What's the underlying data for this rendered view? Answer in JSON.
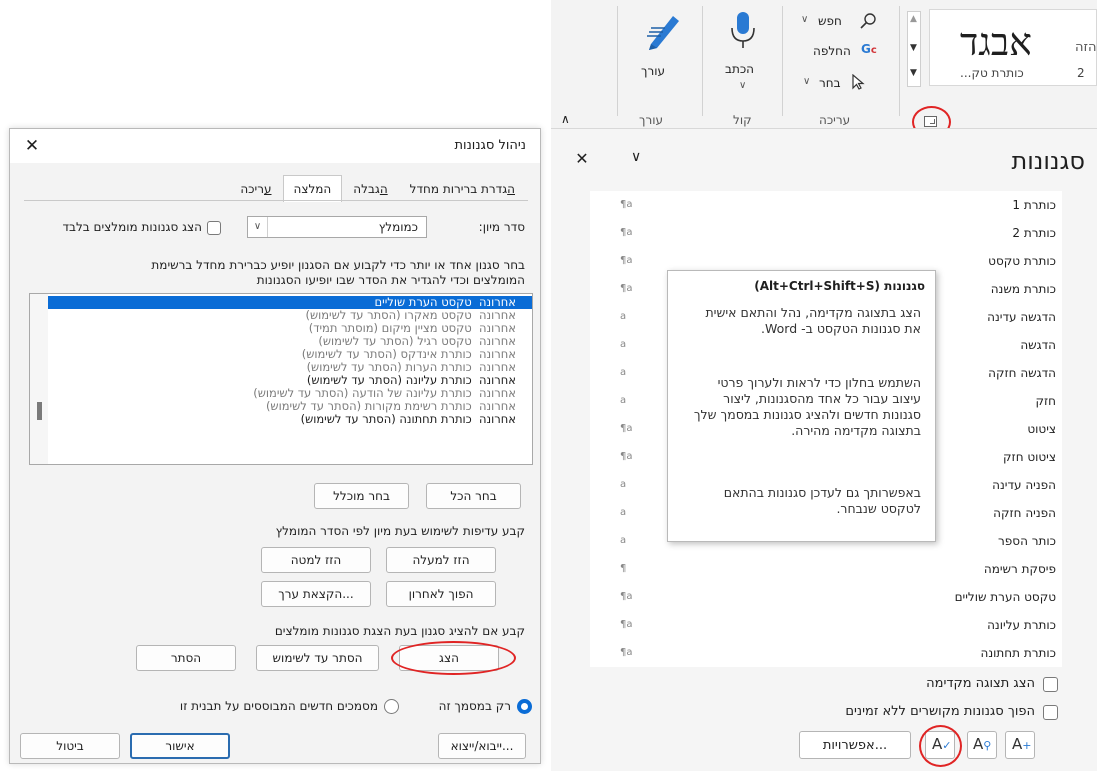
{
  "dialog": {
    "title": "ניהול סגנונות",
    "close_glyph": "✕",
    "tabs": [
      {
        "label": "עריכה",
        "underline": "ע",
        "rest": "ריכה"
      },
      {
        "label": "המלצה"
      },
      {
        "label": "הגבלה",
        "underline": "ה",
        "rest": "גבלה"
      },
      {
        "label": "הגדרת ברירות מחדל",
        "underline": "ה",
        "rest": "גדרת ברירות מחדל"
      }
    ],
    "sort_label": "סדר מיון:",
    "sort_value": "כמומלץ",
    "show_recommended_label": "הצג סגנונות מומלצים בלבד",
    "instructions": [
      "בחר סגנון אחד או יותר כדי לקבוע אם הסגנון יופיע כברירת מחדל ברשימת",
      "המומלצים וכדי להגדיר את הסדר שבו יופיעו הסגנונות"
    ],
    "list": [
      {
        "pri": "אחרונה",
        "text": "טקסט הערת שוליים"
      },
      {
        "pri": "אחרונה",
        "text": "טקסט מאקרו  (הסתר עד לשימוש)"
      },
      {
        "pri": "אחרונה",
        "text": "טקסט מציין מיקום  (מוסתר תמיד)"
      },
      {
        "pri": "אחרונה",
        "text": "טקסט רגיל  (הסתר עד לשימוש)"
      },
      {
        "pri": "אחרונה",
        "text": "כותרת אינדקס  (הסתר עד לשימוש)"
      },
      {
        "pri": "אחרונה",
        "text": "כותרת הערות  (הסתר עד לשימוש)"
      },
      {
        "pri": "אחרונה",
        "text": "כותרת עליונה  (הסתר עד לשימוש)"
      },
      {
        "pri": "אחרונה",
        "text": "כותרת עליונה של הודעה  (הסתר עד לשימוש)"
      },
      {
        "pri": "אחרונה",
        "text": "כותרת רשימת מקורות  (הסתר עד לשימוש)"
      },
      {
        "pri": "אחרונה",
        "text": "כותרת תחתונה  (הסתר עד לשימוש)"
      }
    ],
    "select_all": "בחר הכל",
    "select_builtin": "בחר מוכלל",
    "priority_label": "קבע עדיפות לשימוש בעת מיון לפי הסדר המומלץ",
    "move_up": "הזז למעלה",
    "move_down": "הזז למטה",
    "move_last": "הפוך לאחרון",
    "assign_value": "הקצאת ערך...",
    "visibility_label": "קבע אם להציג סגנון בעת הצגת סגנונות מומלצים",
    "show": "הצג",
    "hide_until_used": "הסתר עד לשימוש",
    "hide": "הסתר",
    "radio_this_doc": "רק במסמך זה",
    "radio_new_docs": "מסמכים חדשים המבוססים על תבנית זו",
    "import_export": "ייבוא/ייצוא...",
    "ok": "אישור",
    "cancel": "ביטול"
  },
  "ribbon": {
    "style_sample": "אבגד",
    "style_sample_partial": "הזה",
    "style_name": "כותרת טק...",
    "style_index": "2",
    "find": "חפש",
    "replace": "החלפה",
    "select": "בחר",
    "group_editing": "עריכה",
    "dictate": "הכתב",
    "group_voice": "קול",
    "editor": "עורך",
    "group_editor": "עורך"
  },
  "pane": {
    "title": "סגנונות",
    "close_glyph": "✕",
    "styles": [
      {
        "name": "כותרת 1",
        "kind": "¶a"
      },
      {
        "name": "כותרת 2",
        "kind": "¶a"
      },
      {
        "name": "כותרת טקסט",
        "kind": "¶a"
      },
      {
        "name": "כותרת משנה",
        "kind": "¶a"
      },
      {
        "name": "הדגשה עדינה",
        "kind": "a"
      },
      {
        "name": "הדגשה",
        "kind": "a"
      },
      {
        "name": "הדגשה חזקה",
        "kind": "a"
      },
      {
        "name": "חזק",
        "kind": "a"
      },
      {
        "name": "ציטוט",
        "kind": "¶a"
      },
      {
        "name": "ציטוט חזק",
        "kind": "¶a"
      },
      {
        "name": "הפניה עדינה",
        "kind": "a"
      },
      {
        "name": "הפניה חזקה",
        "kind": "a"
      },
      {
        "name": "כותר הספר",
        "kind": "a"
      },
      {
        "name": "פיסקת רשימה",
        "kind": "¶"
      },
      {
        "name": "טקסט הערת שוליים",
        "kind": "¶a"
      },
      {
        "name": "כותרת עליונה",
        "kind": "¶a"
      },
      {
        "name": "כותרת תחתונה",
        "kind": "¶a"
      }
    ],
    "tooltip": {
      "title": "סגנונות (Alt+Ctrl+Shift+S)",
      "p1": "הצג בתצוגה מקדימה, נהל והתאם אישית את סגנונות הטקסט ב- Word.",
      "p2": "השתמש בחלון כדי לראות ולערוך פרטי עיצוב עבור כל אחד מהסגנונות, ליצור סגנונות חדשים ולהציג סגנונות במסמך שלך בתצוגה מקדימה מהירה.",
      "p3": "באפשרותך גם לעדכן סגנונות בהתאם לטקסט שנבחר."
    },
    "show_preview": "הצג תצוגה מקדימה",
    "disable_linked": "הפוך סגנונות מקושרים ללא זמינים",
    "options": "אפשרויות..."
  },
  "colors": {
    "accent": "#0a6cd6",
    "highlight_circle": "#e02424"
  }
}
